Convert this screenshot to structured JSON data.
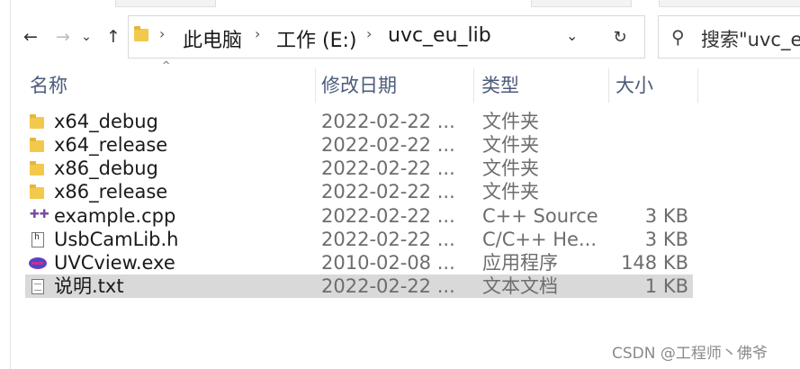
{
  "address_bar": {
    "breadcrumbs": [
      "此电脑",
      "工作 (E:)",
      "uvc_eu_lib"
    ],
    "separator": "›",
    "dropdown_icon": "chevron-down-icon",
    "refresh_icon": "refresh-icon"
  },
  "nav": {
    "back_icon": "←",
    "forward_icon": "→",
    "recent_icon": "⌄",
    "up_icon": "↑"
  },
  "search": {
    "placeholder": "搜索\"uvc_eu_lib\"",
    "icon": "search-icon"
  },
  "columns": {
    "name": "名称",
    "date": "修改日期",
    "type": "类型",
    "size": "大小",
    "sort_indicator": "^"
  },
  "files": [
    {
      "name": "x64_debug",
      "date": "2022-02-22 ...",
      "type": "文件夹",
      "size": "",
      "icon": "folder-icon",
      "selected": false
    },
    {
      "name": "x64_release",
      "date": "2022-02-22 ...",
      "type": "文件夹",
      "size": "",
      "icon": "folder-icon",
      "selected": false
    },
    {
      "name": "x86_debug",
      "date": "2022-02-22 ...",
      "type": "文件夹",
      "size": "",
      "icon": "folder-icon",
      "selected": false
    },
    {
      "name": "x86_release",
      "date": "2022-02-22 ...",
      "type": "文件夹",
      "size": "",
      "icon": "folder-icon",
      "selected": false
    },
    {
      "name": "example.cpp",
      "date": "2022-02-22 ...",
      "type": "C++ Source",
      "size": "3 KB",
      "icon": "cpp-file-icon",
      "selected": false
    },
    {
      "name": "UsbCamLib.h",
      "date": "2022-02-22 ...",
      "type": "C/C++ He...",
      "size": "3 KB",
      "icon": "header-file-icon",
      "selected": false
    },
    {
      "name": "UVCview.exe",
      "date": "2010-02-08 ...",
      "type": "应用程序",
      "size": "148 KB",
      "icon": "exe-file-icon",
      "selected": false
    },
    {
      "name": "说明.txt",
      "date": "2022-02-22 ...",
      "type": "文本文档",
      "size": "1 KB",
      "icon": "text-file-icon",
      "selected": true
    }
  ],
  "watermark": "CSDN @工程师丶佛爷",
  "colors": {
    "header_text": "#4a5b7a",
    "selected_row": "#d9d9d9",
    "folder": "#f2c94c"
  }
}
